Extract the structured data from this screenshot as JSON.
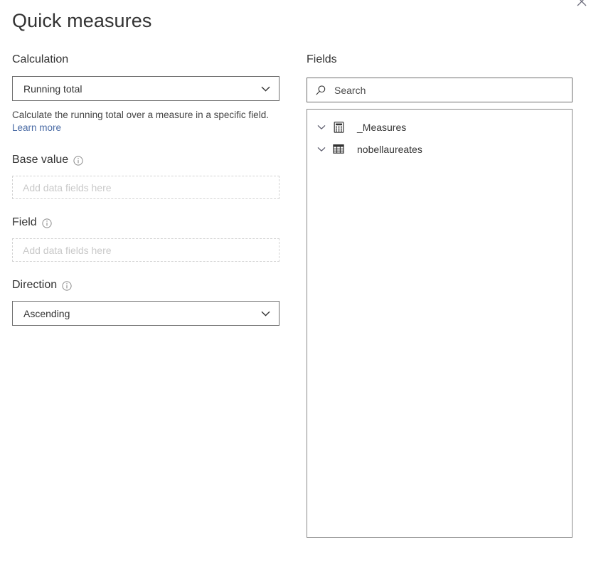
{
  "window": {
    "title": "Quick measures",
    "close_icon": "close-icon"
  },
  "calculation": {
    "label": "Calculation",
    "selected": "Running total",
    "options": [
      "Running total"
    ],
    "chevron_icon": "chevron-down-icon",
    "help_text": "Calculate the running total over a measure in a specific field.",
    "help_link": "Learn more"
  },
  "base_value": {
    "label": "Base value",
    "info_icon": "info-icon",
    "placeholder": "Add data fields here"
  },
  "field": {
    "label": "Field",
    "info_icon": "info-icon",
    "placeholder": "Add data fields here"
  },
  "direction": {
    "label": "Direction",
    "info_icon": "info-icon",
    "selected": "Ascending",
    "options": [
      "Ascending"
    ],
    "chevron_icon": "chevron-down-icon"
  },
  "fields_panel": {
    "title": "Fields",
    "search": {
      "placeholder": "Search",
      "value": "",
      "icon": "search-icon"
    },
    "tree": [
      {
        "label": "_Measures",
        "icon": "calculator-icon",
        "expander": "chevron-down-icon",
        "expanded": true
      },
      {
        "label": "nobellaureates",
        "icon": "table-icon",
        "expander": "chevron-down-icon",
        "expanded": true
      }
    ]
  },
  "colors": {
    "text": "#333333",
    "link": "#4a6ba5",
    "border": "#6e6e6e",
    "placeholder": "#c9c9c9",
    "panel_border": "#8a8a8a"
  }
}
